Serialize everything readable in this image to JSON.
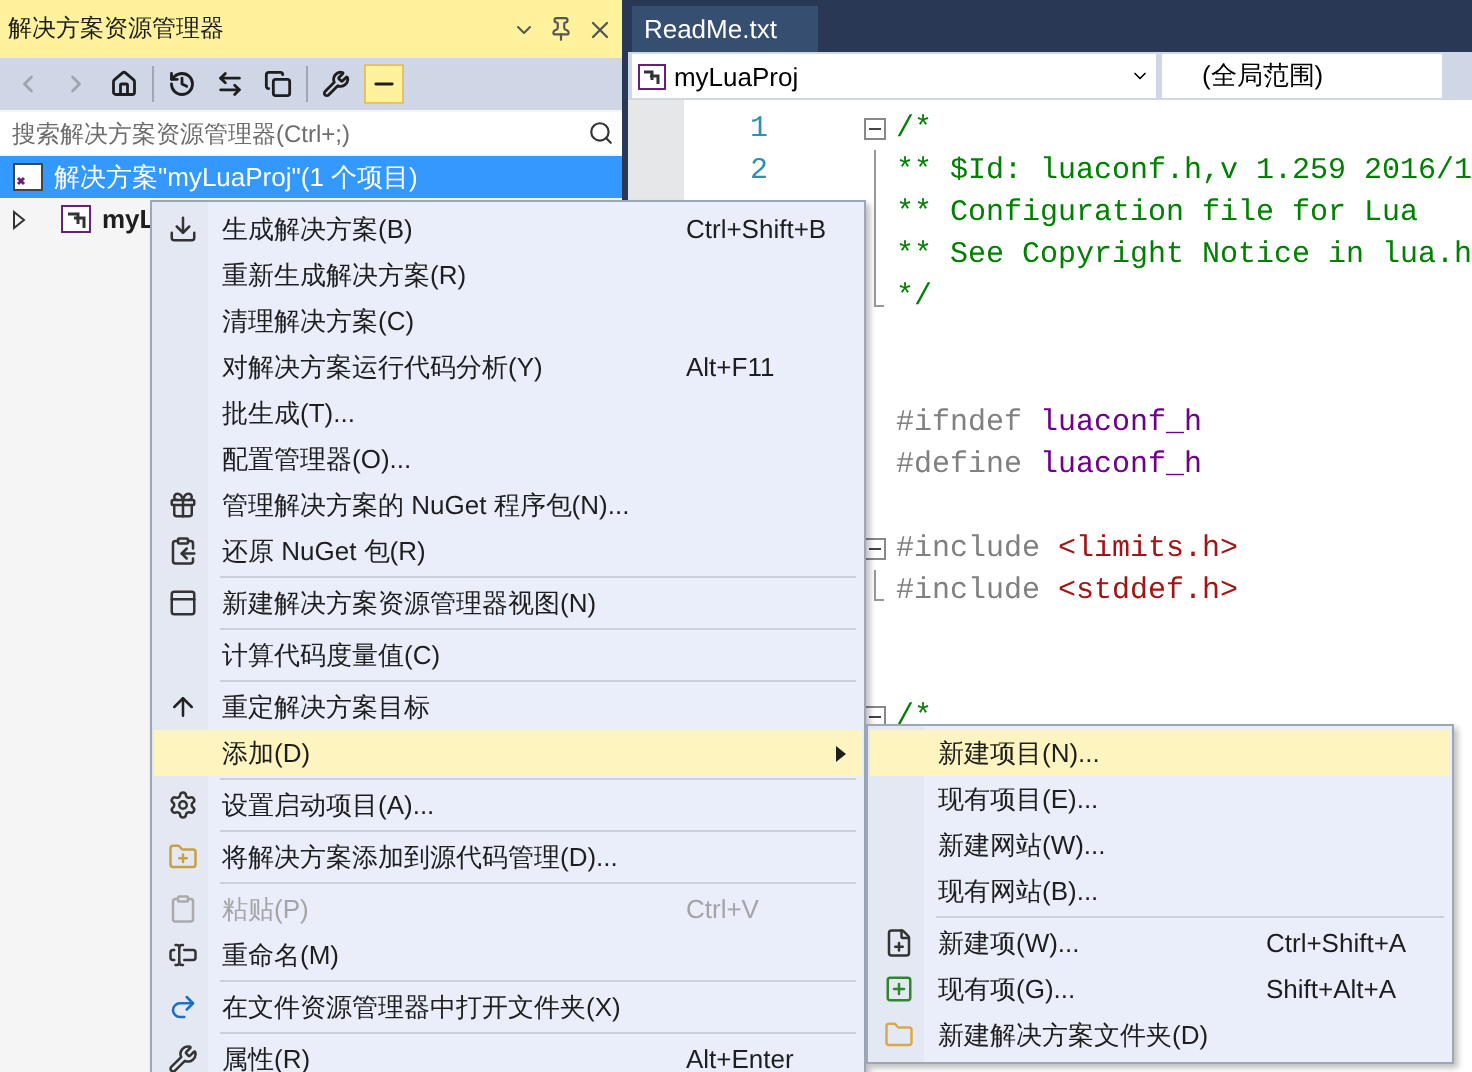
{
  "explorer": {
    "title": "解决方案资源管理器",
    "toolbar": [
      {
        "kind": "back",
        "disabled": true,
        "selected": false
      },
      {
        "kind": "forward",
        "disabled": true,
        "selected": false
      },
      {
        "kind": "home",
        "disabled": false,
        "selected": false
      },
      {
        "kind": "history",
        "disabled": false,
        "selected": false
      },
      {
        "kind": "sync",
        "disabled": false,
        "selected": false
      },
      {
        "kind": "collapse",
        "disabled": false,
        "selected": false
      },
      {
        "kind": "properties",
        "disabled": false,
        "selected": false
      },
      {
        "kind": "preview",
        "disabled": false,
        "selected": true
      }
    ],
    "search": {
      "placeholder": "搜索解决方案资源管理器(Ctrl+;)"
    },
    "tree": [
      {
        "label": "解决方案\"myLuaProj\"(1 个项目)",
        "selected": true,
        "bold": false,
        "children": [
          {
            "label": "myL",
            "selected": false,
            "bold": true,
            "expanded": false
          }
        ]
      }
    ]
  },
  "editor": {
    "tab": "ReadMe.txt",
    "project_dropdown": "myLuaProj",
    "scope_dropdown": "(全局范围)",
    "lines": [
      {
        "number": "1",
        "kind": "start",
        "tokens": [
          {
            "kind": "comment",
            "text": "/*"
          }
        ]
      },
      {
        "number": "2",
        "kind": "body",
        "tokens": [
          {
            "kind": "comment",
            "text": "** $Id: luaconf.h,v 1.259 2016/1"
          }
        ]
      },
      {
        "kind": "body",
        "tokens": [
          {
            "kind": "comment",
            "text": "** Configuration file for Lua"
          }
        ]
      },
      {
        "kind": "body",
        "tokens": [
          {
            "kind": "comment",
            "text": "** See Copyright Notice in lua.h"
          }
        ]
      },
      {
        "kind": "end",
        "tokens": [
          {
            "kind": "comment",
            "text": "*/"
          }
        ]
      },
      {
        "kind": "plain"
      },
      {
        "kind": "plain"
      },
      {
        "kind": "plain",
        "tokens": [
          {
            "kind": "directive",
            "text": "#ifndef"
          },
          {
            "kind": "macro",
            "text": " luaconf_h"
          }
        ]
      },
      {
        "kind": "plain",
        "tokens": [
          {
            "kind": "directive",
            "text": "#define"
          },
          {
            "kind": "macro",
            "text": " luaconf_h"
          }
        ]
      },
      {
        "kind": "plain"
      },
      {
        "kind": "start",
        "tokens": [
          {
            "kind": "directive",
            "text": "#include "
          },
          {
            "kind": "string",
            "text": "<limits.h>"
          }
        ]
      },
      {
        "kind": "end",
        "tokens": [
          {
            "kind": "directive",
            "text": "#include "
          },
          {
            "kind": "string",
            "text": "<stddef.h>"
          }
        ]
      },
      {
        "kind": "plain"
      },
      {
        "kind": "plain"
      },
      {
        "kind": "start",
        "tokens": [
          {
            "kind": "comment",
            "text": "/*"
          }
        ]
      }
    ]
  },
  "context_menu": [
    {
      "kind": "item",
      "label": "生成解决方案(B)",
      "shortcut": "Ctrl+Shift+B",
      "disabled": false,
      "selected": false
    },
    {
      "kind": "item",
      "label": "重新生成解决方案(R)",
      "disabled": false,
      "selected": false
    },
    {
      "kind": "item",
      "label": "清理解决方案(C)",
      "disabled": false,
      "selected": false
    },
    {
      "kind": "item",
      "label": "对解决方案运行代码分析(Y)",
      "shortcut": "Alt+F11",
      "disabled": false,
      "selected": false
    },
    {
      "kind": "item",
      "label": "批生成(T)...",
      "disabled": false,
      "selected": false
    },
    {
      "kind": "item",
      "label": "配置管理器(O)...",
      "disabled": false,
      "selected": false
    },
    {
      "kind": "item",
      "label": "管理解决方案的 NuGet 程序包(N)...",
      "disabled": false,
      "selected": false
    },
    {
      "kind": "item",
      "label": "还原 NuGet 包(R)",
      "disabled": false,
      "selected": false
    },
    {
      "kind": "separator"
    },
    {
      "kind": "item",
      "label": "新建解决方案资源管理器视图(N)",
      "disabled": false,
      "selected": false
    },
    {
      "kind": "separator"
    },
    {
      "kind": "item",
      "label": "计算代码度量值(C)",
      "disabled": false,
      "selected": false
    },
    {
      "kind": "separator"
    },
    {
      "kind": "item",
      "label": "重定解决方案目标",
      "disabled": false,
      "selected": false
    },
    {
      "kind": "submenu",
      "label": "添加(D)",
      "disabled": false,
      "selected": true
    },
    {
      "kind": "separator"
    },
    {
      "kind": "item",
      "label": "设置启动项目(A)...",
      "disabled": false,
      "selected": false
    },
    {
      "kind": "separator"
    },
    {
      "kind": "item",
      "label": "将解决方案添加到源代码管理(D)...",
      "disabled": false,
      "selected": false
    },
    {
      "kind": "separator"
    },
    {
      "kind": "item",
      "label": "粘贴(P)",
      "shortcut": "Ctrl+V",
      "disabled": true,
      "selected": false
    },
    {
      "kind": "item",
      "label": "重命名(M)",
      "disabled": false,
      "selected": false
    },
    {
      "kind": "separator"
    },
    {
      "kind": "item",
      "label": "在文件资源管理器中打开文件夹(X)",
      "disabled": false,
      "selected": false
    },
    {
      "kind": "separator"
    },
    {
      "kind": "item",
      "label": "属性(R)",
      "shortcut": "Alt+Enter",
      "disabled": false,
      "selected": false
    }
  ],
  "submenu": [
    {
      "kind": "item",
      "label": "新建项目(N)...",
      "disabled": false,
      "selected": true
    },
    {
      "kind": "item",
      "label": "现有项目(E)...",
      "disabled": false,
      "selected": false
    },
    {
      "kind": "item",
      "label": "新建网站(W)...",
      "disabled": false,
      "selected": false
    },
    {
      "kind": "item",
      "label": "现有网站(B)...",
      "disabled": false,
      "selected": false
    },
    {
      "kind": "separator"
    },
    {
      "kind": "item",
      "label": "新建项(W)...",
      "shortcut": "Ctrl+Shift+A",
      "disabled": false,
      "selected": false
    },
    {
      "kind": "item",
      "label": "现有项(G)...",
      "shortcut": "Shift+Alt+A",
      "disabled": false,
      "selected": false
    },
    {
      "kind": "item",
      "label": "新建解决方案文件夹(D)",
      "disabled": false,
      "selected": false
    }
  ]
}
